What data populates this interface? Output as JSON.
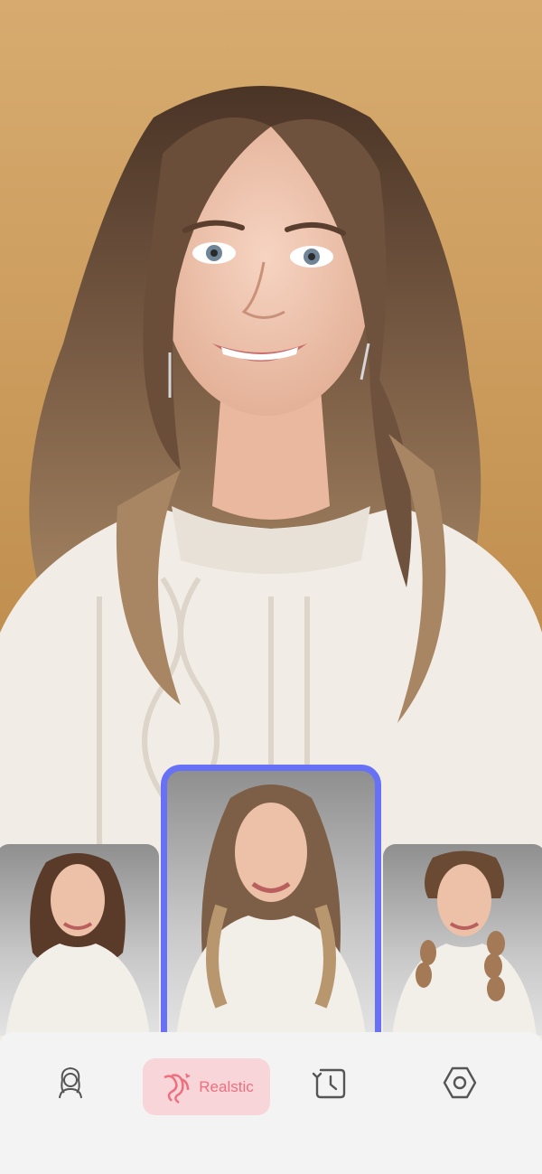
{
  "hero": {
    "icon": "portrait-photo"
  },
  "carousel": {
    "items": [
      {
        "icon": "portrait-curly-thumbnail"
      },
      {
        "icon": "portrait-realistic-thumbnail",
        "selected": true
      },
      {
        "icon": "portrait-braid-thumbnail"
      }
    ],
    "accent": "#6671f5"
  },
  "bottom_nav": {
    "items": [
      {
        "icon": "portrait-icon"
      },
      {
        "icon": "hair-style-icon",
        "label": "Realstic",
        "active": true
      },
      {
        "icon": "history-icon"
      },
      {
        "icon": "settings-icon"
      }
    ],
    "active_bg": "#f8d5d9",
    "active_color": "#ee6f7d",
    "bar_bg": "#f3f3f3"
  }
}
